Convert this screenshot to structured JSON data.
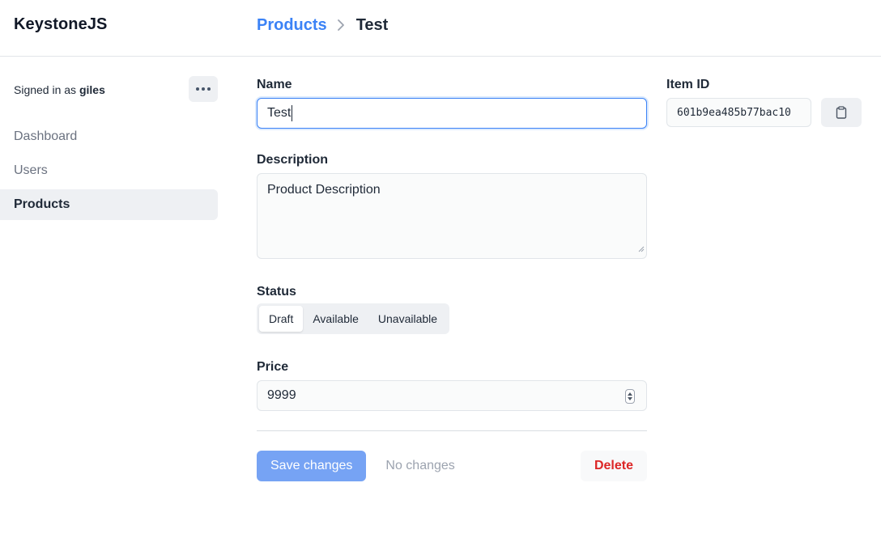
{
  "app": {
    "title": "KeystoneJS"
  },
  "breadcrumb": {
    "parent": "Products",
    "current": "Test"
  },
  "sidebar": {
    "signed_in_prefix": "Signed in as",
    "username": "giles",
    "menu_icon": "more-horizontal-icon",
    "items": [
      {
        "label": "Dashboard",
        "active": false
      },
      {
        "label": "Users",
        "active": false
      },
      {
        "label": "Products",
        "active": true
      }
    ]
  },
  "form": {
    "name": {
      "label": "Name",
      "value": "Test"
    },
    "description": {
      "label": "Description",
      "value": "Product Description"
    },
    "status": {
      "label": "Status",
      "options": [
        "Draft",
        "Available",
        "Unavailable"
      ],
      "selected": "Draft"
    },
    "price": {
      "label": "Price",
      "value": "9999"
    }
  },
  "item_id": {
    "label": "Item ID",
    "value": "601b9ea485b77bac10",
    "copy_icon": "clipboard-icon"
  },
  "actions": {
    "save_label": "Save changes",
    "status_text": "No changes",
    "delete_label": "Delete"
  },
  "colors": {
    "accent": "#3b82f6",
    "save_button": "#76a3f4",
    "delete_text": "#dc2626"
  }
}
